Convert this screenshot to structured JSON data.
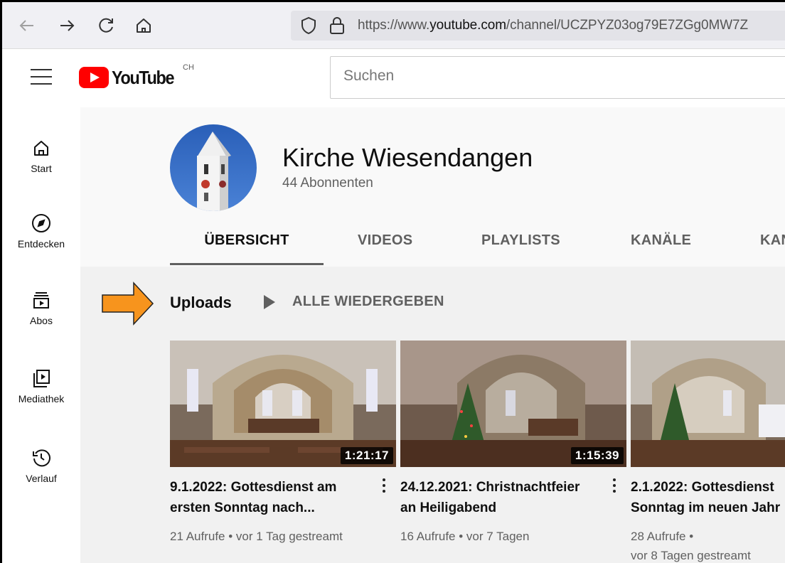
{
  "browser": {
    "url_prefix": "https://www.",
    "url_domain": "youtube.com",
    "url_path": "/channel/UCZPYZ03og79E7ZGg0MW7Z"
  },
  "youtube": {
    "logo_text": "YouTube",
    "country_code": "CH",
    "search_placeholder": "Suchen"
  },
  "sidebar": {
    "items": [
      {
        "label": "Start",
        "icon": "home-icon"
      },
      {
        "label": "Entdecken",
        "icon": "compass-icon"
      },
      {
        "label": "Abos",
        "icon": "subscriptions-icon"
      },
      {
        "label": "Mediathek",
        "icon": "library-icon"
      },
      {
        "label": "Verlauf",
        "icon": "history-icon"
      }
    ]
  },
  "channel": {
    "name": "Kirche Wiesendangen",
    "subscribers": "44 Abonnenten",
    "tabs": [
      "ÜBERSICHT",
      "VIDEOS",
      "PLAYLISTS",
      "KANÄLE",
      "KAN"
    ],
    "active_tab": 0
  },
  "uploads": {
    "title": "Uploads",
    "play_all": "ALLE WIEDERGEBEN",
    "videos": [
      {
        "title_line1": "9.1.2022: Gottesdienst am",
        "title_line2": "ersten Sonntag nach...",
        "duration": "1:21:17",
        "meta_line1": "21 Aufrufe • vor 1 Tag gestreamt",
        "meta_line2": ""
      },
      {
        "title_line1": "24.12.2021: Christnachtfeier",
        "title_line2": "an Heiligabend",
        "duration": "1:15:39",
        "meta_line1": "16 Aufrufe • vor 7 Tagen",
        "meta_line2": ""
      },
      {
        "title_line1": "2.1.2022: Gottesdienst",
        "title_line2": "Sonntag im neuen Jahr",
        "duration": "",
        "meta_line1": "28 Aufrufe •",
        "meta_line2": "vor 8 Tagen gestreamt"
      }
    ]
  },
  "colors": {
    "brand_red": "#ff0000",
    "annotation_arrow": "#f7941d"
  }
}
